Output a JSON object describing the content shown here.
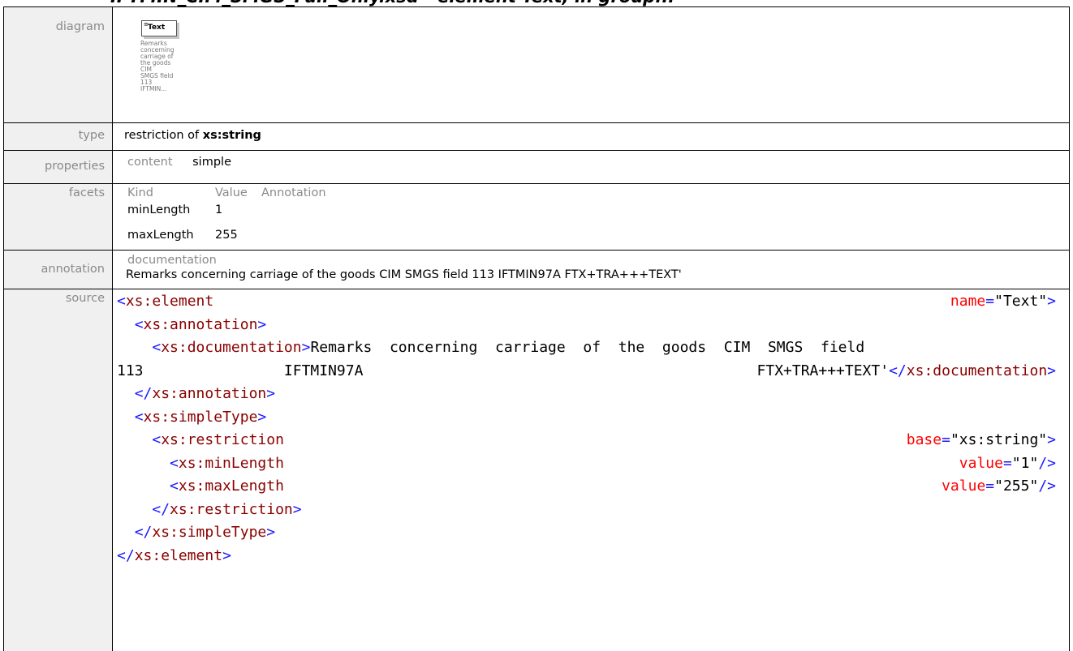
{
  "header": {
    "title": "IFTMIN_CIM_SMGS_Full_Only.xsd - element Text, in group..."
  },
  "rows": {
    "diagram": {
      "label": "diagram",
      "element_name": "Text",
      "doc_preview": [
        "Remarks",
        "concerning",
        "carriage of",
        "the goods",
        "CIM",
        "SMGS field",
        "113",
        "IFTMIN..."
      ]
    },
    "type": {
      "label": "type",
      "prefix": "restriction of ",
      "base": "xs:string"
    },
    "properties": {
      "label": "properties",
      "key": "content",
      "value": "simple"
    },
    "facets": {
      "label": "facets",
      "headers": [
        "Kind",
        "Value",
        "Annotation"
      ],
      "items": [
        {
          "kind": "minLength",
          "value": "1",
          "annotation": ""
        },
        {
          "kind": "maxLength",
          "value": "255",
          "annotation": ""
        }
      ]
    },
    "annotation": {
      "label": "annotation",
      "heading": "documentation",
      "text": "Remarks concerning carriage of the goods CIM SMGS field 113 IFTMIN97A FTX+TRA+++TEXT'"
    },
    "source": {
      "label": "source",
      "lines": {
        "l1_tag": "xs:element",
        "l1_attr": "name",
        "l1_val": "\"Text\"",
        "l2_tag": "xs:annotation",
        "l3_tag": "xs:documentation",
        "l3_text": "Remarks  concerning  carriage  of  the  goods  CIM  SMGS  field",
        "l4_a": "113",
        "l4_b": "IFTMIN97A",
        "l4_c": "FTX+TRA+++TEXT'",
        "l4_tag": "xs:documentation",
        "l5_tag": "xs:annotation",
        "l6_tag": "xs:simpleType",
        "l7_tag": "xs:restriction",
        "l7_attr": "base",
        "l7_val": "\"xs:string\"",
        "l8_tag": "xs:minLength",
        "l8_attr": "value",
        "l8_val": "\"1\"",
        "l9_tag": "xs:maxLength",
        "l9_attr": "value",
        "l9_val": "\"255\"",
        "l10_tag": "xs:restriction",
        "l11_tag": "xs:simpleType",
        "l12_tag": "xs:element"
      }
    }
  }
}
